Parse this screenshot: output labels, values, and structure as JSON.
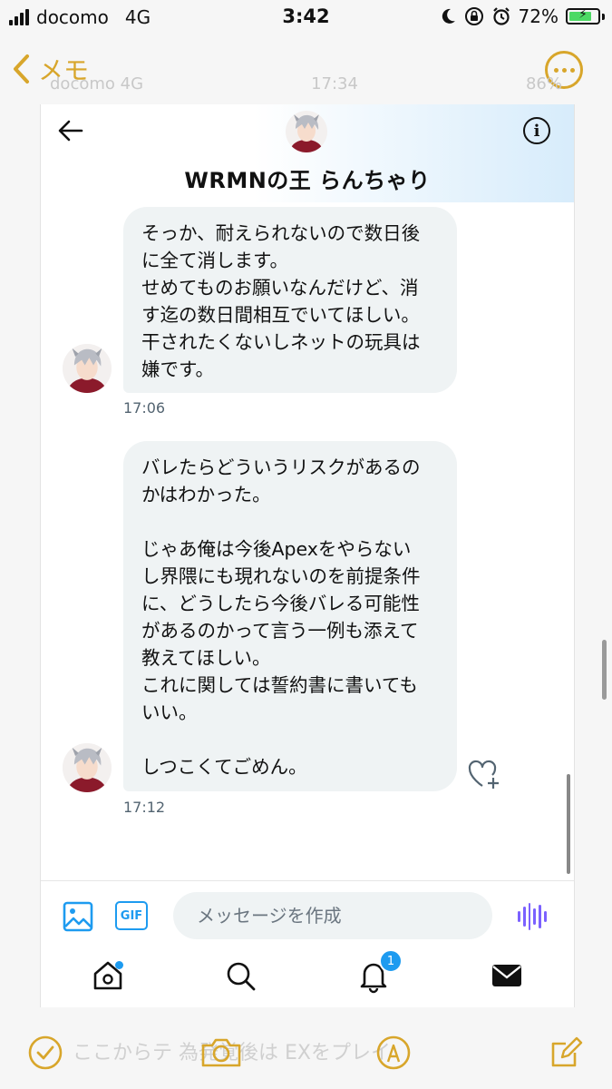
{
  "status_bar": {
    "carrier": "docomo",
    "network": "4G",
    "time": "3:42",
    "battery": "72%"
  },
  "notes": {
    "back_label": "メモ",
    "ghost_status": {
      "carrier": "docomo 4G",
      "time": "17:34",
      "battery": "86%"
    },
    "ghost_text_line1": "ここからテ    為発覚後は  EXをプレイ",
    "ghost_text_line2": "…"
  },
  "dm": {
    "contact_name": "WRMNの王 らんちゃり",
    "messages": [
      {
        "text": "そっか、耐えられないので数日後\nに全て消します。\nせめてものお願いなんだけど、消\nす迄の数日間相互でいてほしい。\n干されたくないしネットの玩具は\n嫌です。",
        "time": "17:06"
      },
      {
        "text": "バレたらどういうリスクがあるの\nかはわかった。\n\nじゃあ俺は今後Apexをやらない\nし界隈にも現れないのを前提条件\nに、どうしたら今後バレる可能性\nがあるのかって言う一例も添えて\n教えてほしい。\nこれに関しては誓約書に書いても\nいい。\n\nしつこくてごめん。",
        "time": "17:12"
      }
    ],
    "composer": {
      "gif_label": "GIF",
      "placeholder": "メッセージを作成"
    },
    "tabs": {
      "notifications_badge": "1"
    }
  },
  "colors": {
    "notes_accent": "#d8a62b",
    "twitter_blue": "#1d9bf0",
    "bubble_bg": "#eff3f4",
    "voice_purple": "#7b61ff"
  },
  "icons": [
    "chevron-left-icon",
    "more-icon",
    "back-arrow-icon",
    "info-icon",
    "image-icon",
    "gif-icon",
    "voice-icon",
    "home-icon",
    "search-icon",
    "bell-icon",
    "mail-icon",
    "like-add-icon",
    "checklist-icon",
    "camera-icon",
    "markup-icon",
    "compose-icon"
  ]
}
